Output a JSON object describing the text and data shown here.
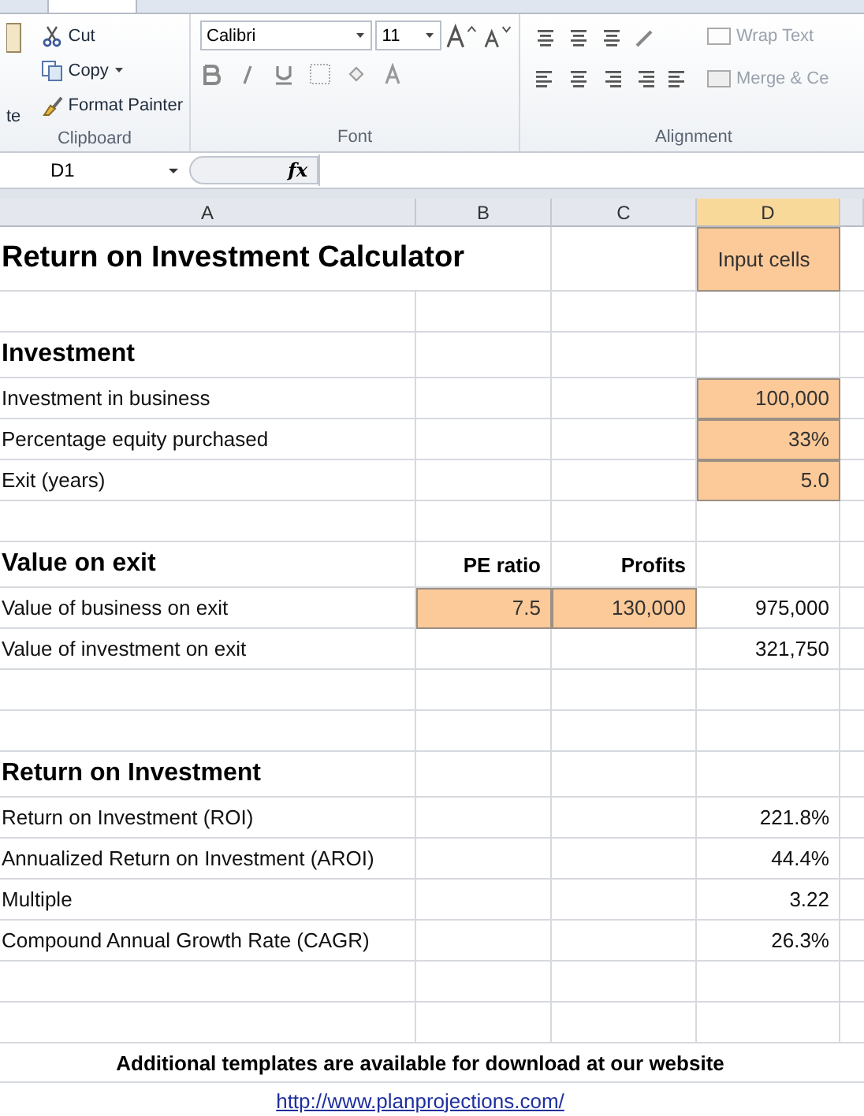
{
  "ribbon": {
    "clipboard": {
      "paste_label": "te",
      "items": [
        "Cut",
        "Copy",
        "Format Painter"
      ],
      "group_label": "Clipboard"
    },
    "font": {
      "font_name": "Calibri",
      "font_size": "11",
      "group_label": "Font"
    },
    "alignment": {
      "wrap_label": "Wrap Text",
      "merge_label": "Merge & Ce",
      "group_label": "Alignment"
    }
  },
  "formula_bar": {
    "name_box": "D1",
    "fx": "fx"
  },
  "columns": [
    {
      "label": "A",
      "selected": false
    },
    {
      "label": "B",
      "selected": false
    },
    {
      "label": "C",
      "selected": false
    },
    {
      "label": "D",
      "selected": true
    }
  ],
  "rows": [
    {
      "kind": "title",
      "cells": [
        {
          "text": "Return on Investment Calculator"
        },
        {},
        {},
        {
          "text": "Input cells",
          "input": true
        }
      ]
    },
    {
      "kind": "blank",
      "cells": [
        {},
        {},
        {},
        {}
      ]
    },
    {
      "kind": "heading",
      "cells": [
        {
          "text": "Investment"
        },
        {},
        {},
        {}
      ]
    },
    {
      "kind": "data",
      "cells": [
        {
          "text": "Investment in business"
        },
        {},
        {},
        {
          "text": "100,000",
          "input": true
        }
      ]
    },
    {
      "kind": "data",
      "cells": [
        {
          "text": "Percentage equity purchased"
        },
        {},
        {},
        {
          "text": "33%",
          "input": true
        }
      ]
    },
    {
      "kind": "data",
      "cells": [
        {
          "text": "Exit (years)"
        },
        {},
        {},
        {
          "text": "5.0",
          "input": true
        }
      ]
    },
    {
      "kind": "blank",
      "cells": [
        {},
        {},
        {},
        {}
      ]
    },
    {
      "kind": "heading",
      "cells": [
        {
          "text": "Value on exit"
        },
        {
          "text": "PE ratio"
        },
        {
          "text": "Profits"
        },
        {}
      ]
    },
    {
      "kind": "data",
      "cells": [
        {
          "text": "Value of business on exit"
        },
        {
          "text": "7.5",
          "input": true
        },
        {
          "text": "130,000",
          "input": true
        },
        {
          "text": "975,000"
        }
      ]
    },
    {
      "kind": "data",
      "cells": [
        {
          "text": "Value of investment on exit"
        },
        {},
        {},
        {
          "text": "321,750"
        }
      ]
    },
    {
      "kind": "blank",
      "cells": [
        {},
        {},
        {},
        {}
      ]
    },
    {
      "kind": "blank",
      "cells": [
        {},
        {},
        {},
        {}
      ]
    },
    {
      "kind": "heading",
      "cells": [
        {
          "text": "Return on Investment"
        },
        {},
        {},
        {}
      ]
    },
    {
      "kind": "data",
      "cells": [
        {
          "text": "Return on Investment (ROI)"
        },
        {},
        {},
        {
          "text": "221.8%"
        }
      ]
    },
    {
      "kind": "data",
      "cells": [
        {
          "text": "Annualized Return on Investment (AROI)"
        },
        {},
        {},
        {
          "text": "44.4%"
        }
      ]
    },
    {
      "kind": "data",
      "cells": [
        {
          "text": "Multiple"
        },
        {},
        {},
        {
          "text": "3.22"
        }
      ]
    },
    {
      "kind": "data",
      "cells": [
        {
          "text": "Compound Annual Growth Rate (CAGR)"
        },
        {},
        {},
        {
          "text": "26.3%"
        }
      ]
    },
    {
      "kind": "blank",
      "cells": [
        {},
        {},
        {},
        {}
      ]
    },
    {
      "kind": "blank",
      "cells": [
        {},
        {},
        {},
        {}
      ]
    },
    {
      "kind": "note",
      "text": "Additional templates are available for download at our website"
    },
    {
      "kind": "link",
      "text": "http://www.planprojections.com/"
    }
  ]
}
